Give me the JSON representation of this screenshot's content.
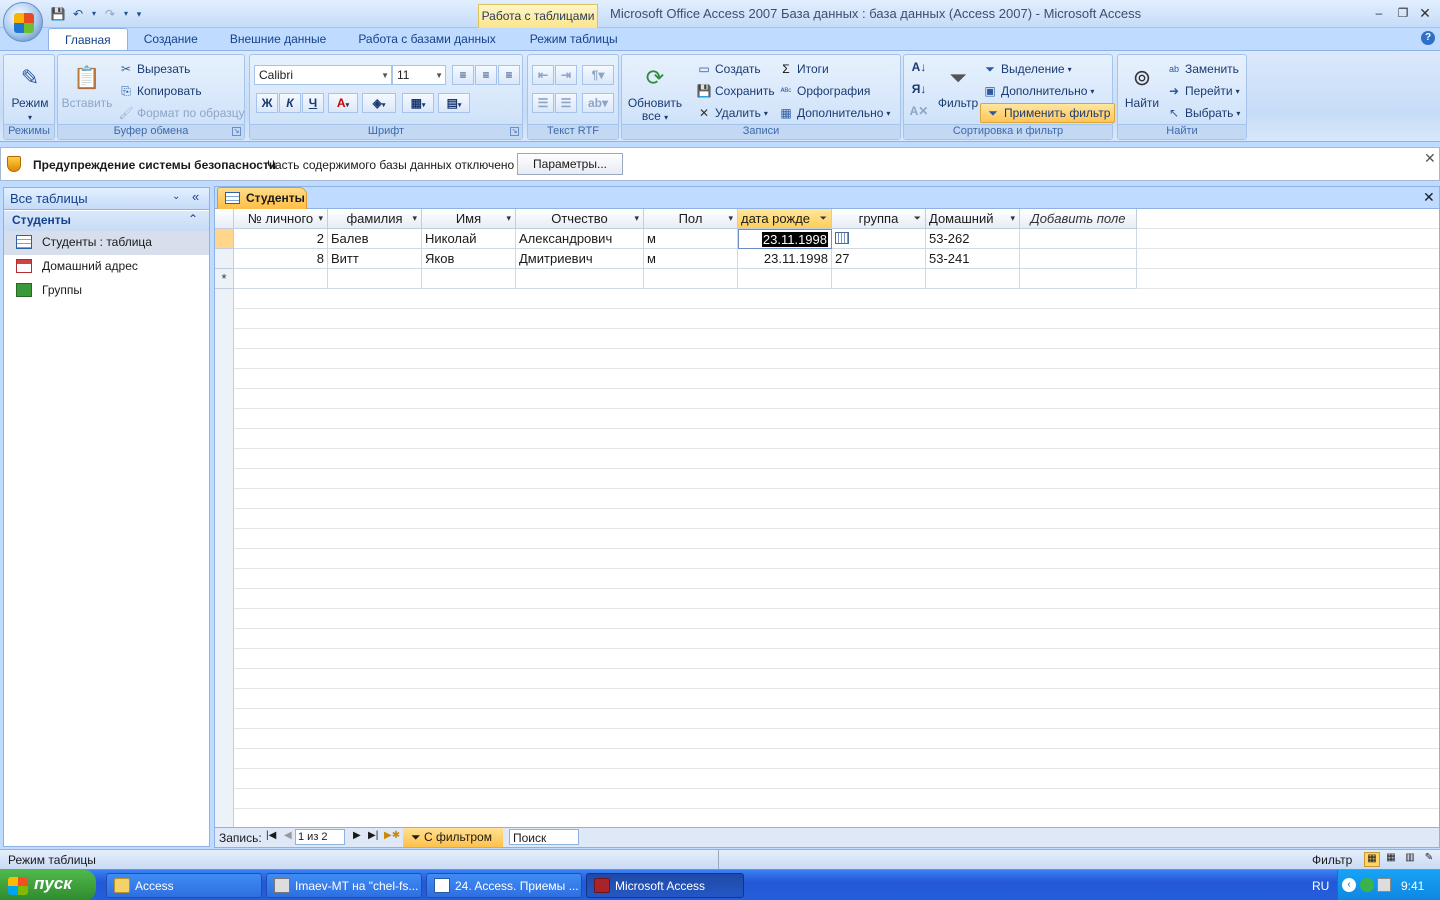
{
  "app": {
    "title": "Microsoft Office Access 2007 База данных : база данных (Access 2007) - Microsoft Access",
    "context_tab": "Работа с таблицами"
  },
  "tabs": [
    "Главная",
    "Создание",
    "Внешние данные",
    "Работа с базами данных",
    "Режим таблицы"
  ],
  "ribbon": {
    "views": {
      "label": "Режим",
      "group": "Режимы"
    },
    "clipboard": {
      "paste": "Вставить",
      "cut": "Вырезать",
      "copy": "Копировать",
      "format_painter": "Формат по образцу",
      "group": "Буфер обмена"
    },
    "font": {
      "name": "Calibri",
      "size": "11",
      "bold": "Ж",
      "italic": "К",
      "underline": "Ч",
      "group": "Шрифт"
    },
    "rtf": {
      "group": "Текст RTF"
    },
    "records": {
      "refresh": "Обновить все",
      "new": "Создать",
      "save": "Сохранить",
      "delete": "Удалить",
      "totals": "Итоги",
      "spelling": "Орфография",
      "more": "Дополнительно",
      "group": "Записи"
    },
    "sort": {
      "filter": "Фильтр",
      "selection": "Выделение",
      "advanced": "Дополнительно",
      "toggle_filter": "Применить фильтр",
      "group": "Сортировка и фильтр"
    },
    "find": {
      "find": "Найти",
      "replace": "Заменить",
      "goto": "Перейти",
      "select": "Выбрать",
      "group": "Найти"
    }
  },
  "security": {
    "title": "Предупреждение системы безопасности",
    "message": "Часть содержимого базы данных отключено",
    "button": "Параметры..."
  },
  "nav": {
    "header": "Все таблицы",
    "group": "Студенты",
    "items": [
      "Студенты : таблица",
      "Домашний адрес",
      "Группы"
    ]
  },
  "doc": {
    "tab": "Студенты",
    "columns": [
      "№ личного",
      "фамилия",
      "Имя",
      "Отчество",
      "Пол",
      "дата рожде",
      "группа",
      "Домашний",
      "Добавить поле"
    ],
    "rows": [
      [
        "2",
        "Балев",
        "Николай",
        "Александрович",
        "м",
        "23.11.1998",
        "",
        "53-262"
      ],
      [
        "8",
        "Витт",
        "Яков",
        "Дмитриевич",
        "м",
        "23.11.1998",
        "27",
        "53-241"
      ]
    ],
    "new_row_marker": "*"
  },
  "record_nav": {
    "label": "Запись:",
    "position": "1 из 2",
    "filter": "С фильтром",
    "search": "Поиск"
  },
  "status": {
    "left": "Режим таблицы",
    "right": "Фильтр"
  },
  "taskbar": {
    "start": "пуск",
    "items": [
      "Access",
      "Imaev-MT на \"chel-fs...",
      "24. Access. Приемы ...",
      "Microsoft Access"
    ],
    "lang": "RU",
    "time": "9:41"
  }
}
